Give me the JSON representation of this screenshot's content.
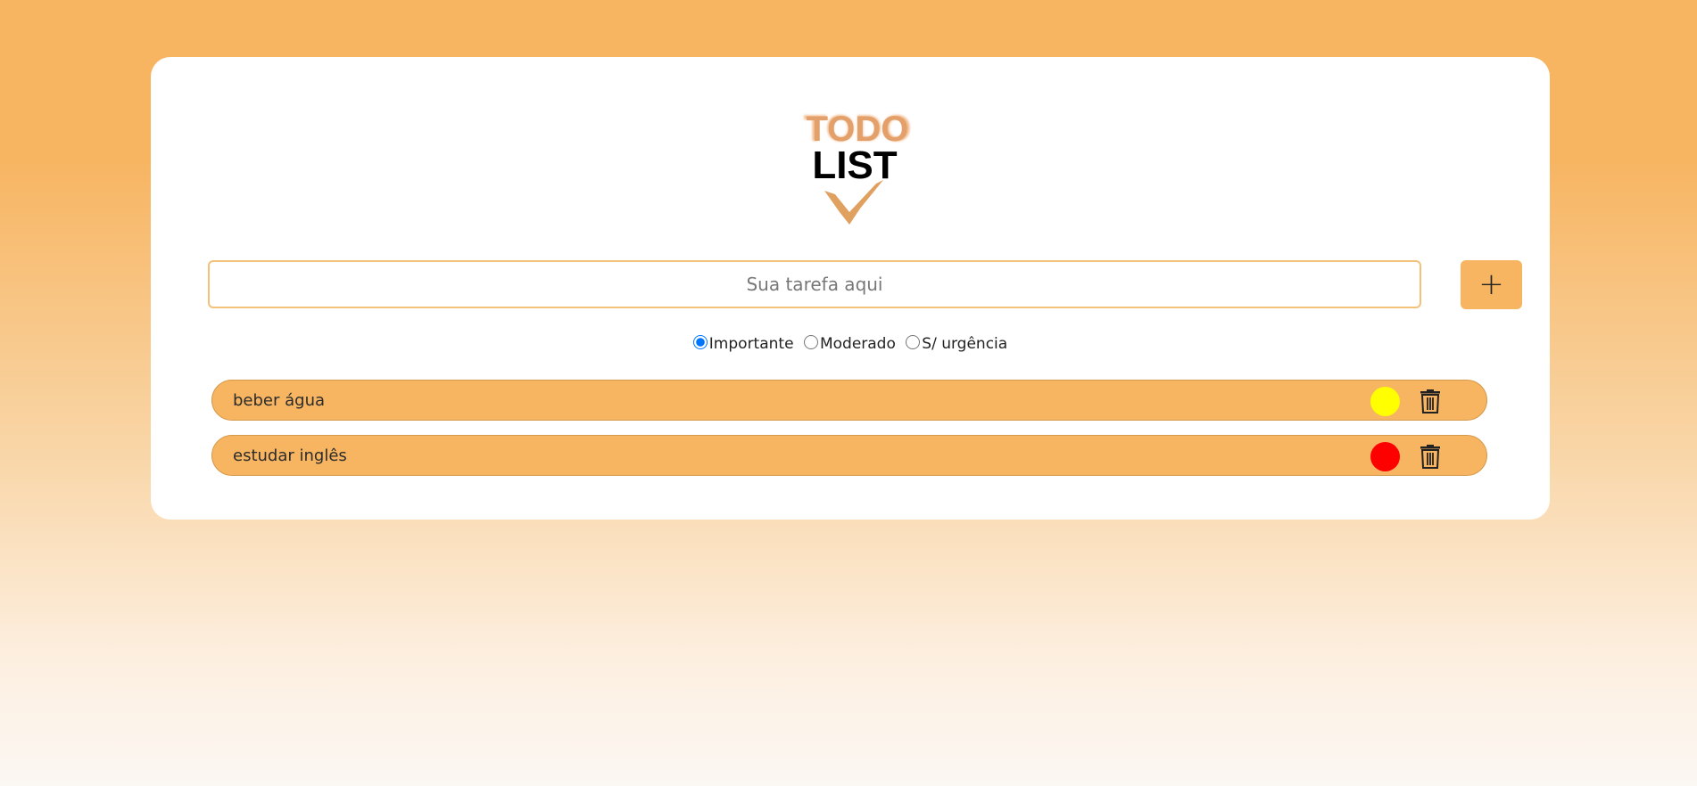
{
  "logo": {
    "line1": "TODO",
    "line2": "LIST",
    "icon": "check-icon",
    "accent_color": "#e0a060"
  },
  "input": {
    "placeholder": "Sua tarefa aqui",
    "value": ""
  },
  "add_button": {
    "label": "+"
  },
  "priority": {
    "options": [
      {
        "label": "Importante",
        "checked": true
      },
      {
        "label": "Moderado",
        "checked": false
      },
      {
        "label": "S/ urgência",
        "checked": false
      }
    ]
  },
  "tasks": [
    {
      "text": "beber água",
      "priority_color": "#ffff00",
      "delete_icon": "trash-icon"
    },
    {
      "text": "estudar inglês",
      "priority_color": "#ff0000",
      "delete_icon": "trash-icon"
    }
  ],
  "colors": {
    "accent": "#f7b562",
    "card": "#ffffff"
  }
}
